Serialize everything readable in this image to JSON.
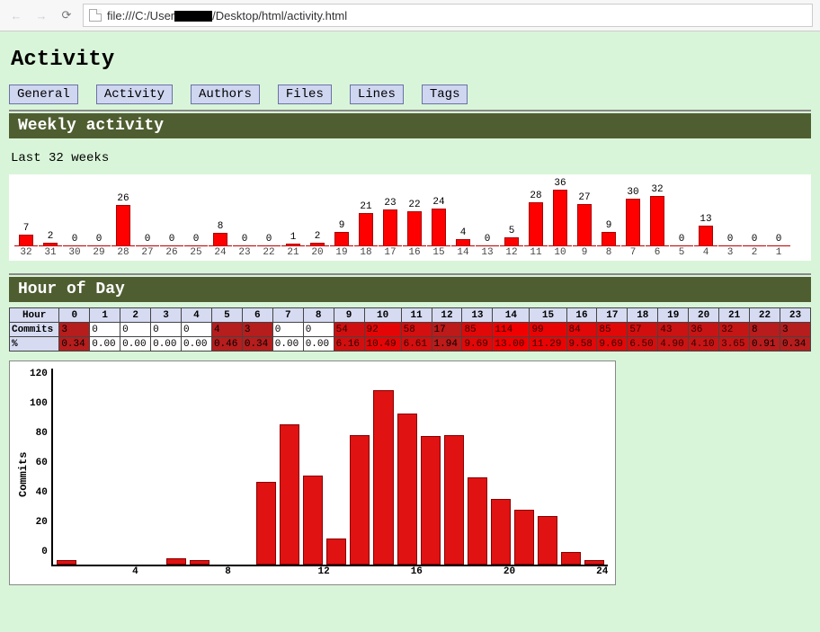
{
  "browser": {
    "url_prefix": "file:///C:/User",
    "url_suffix": "/Desktop/html/activity.html"
  },
  "page": {
    "title": "Activity",
    "tabs": [
      "General",
      "Activity",
      "Authors",
      "Files",
      "Lines",
      "Tags"
    ]
  },
  "weekly": {
    "header": "Weekly activity",
    "subtitle": "Last 32 weeks",
    "weeks": [
      {
        "label": "32",
        "value": 7
      },
      {
        "label": "31",
        "value": 2
      },
      {
        "label": "30",
        "value": 0
      },
      {
        "label": "29",
        "value": 0
      },
      {
        "label": "28",
        "value": 26
      },
      {
        "label": "27",
        "value": 0
      },
      {
        "label": "26",
        "value": 0
      },
      {
        "label": "25",
        "value": 0
      },
      {
        "label": "24",
        "value": 8
      },
      {
        "label": "23",
        "value": 0
      },
      {
        "label": "22",
        "value": 0
      },
      {
        "label": "21",
        "value": 1
      },
      {
        "label": "20",
        "value": 2
      },
      {
        "label": "19",
        "value": 9
      },
      {
        "label": "18",
        "value": 21
      },
      {
        "label": "17",
        "value": 23
      },
      {
        "label": "16",
        "value": 22
      },
      {
        "label": "15",
        "value": 24
      },
      {
        "label": "14",
        "value": 4
      },
      {
        "label": "13",
        "value": 0
      },
      {
        "label": "12",
        "value": 5
      },
      {
        "label": "11",
        "value": 28
      },
      {
        "label": "10",
        "value": 36
      },
      {
        "label": "9",
        "value": 27
      },
      {
        "label": "8",
        "value": 9
      },
      {
        "label": "7",
        "value": 30
      },
      {
        "label": "6",
        "value": 32
      },
      {
        "label": "5",
        "value": 0
      },
      {
        "label": "4",
        "value": 13
      },
      {
        "label": "3",
        "value": 0
      },
      {
        "label": "2",
        "value": 0
      },
      {
        "label": "1",
        "value": 0
      }
    ]
  },
  "hour_of_day": {
    "header": "Hour of Day",
    "col_header": "Hour",
    "row_headers": [
      "Commits",
      "%"
    ],
    "hours": [
      "0",
      "1",
      "2",
      "3",
      "4",
      "5",
      "6",
      "7",
      "8",
      "9",
      "10",
      "11",
      "12",
      "13",
      "14",
      "15",
      "16",
      "17",
      "18",
      "19",
      "20",
      "21",
      "22",
      "23"
    ],
    "commits": [
      3,
      0,
      0,
      0,
      0,
      4,
      3,
      0,
      0,
      54,
      92,
      58,
      17,
      85,
      114,
      99,
      84,
      85,
      57,
      43,
      36,
      32,
      8,
      3
    ],
    "percent": [
      "0.34",
      "0.00",
      "0.00",
      "0.00",
      "0.00",
      "0.46",
      "0.34",
      "0.00",
      "0.00",
      "6.16",
      "10.49",
      "6.61",
      "1.94",
      "9.69",
      "13.00",
      "11.29",
      "9.58",
      "9.69",
      "6.50",
      "4.90",
      "4.10",
      "3.65",
      "0.91",
      "0.34"
    ]
  },
  "chart_data": {
    "type": "bar",
    "title": "",
    "xlabel": "",
    "ylabel": "Commits",
    "ylim": [
      0,
      120
    ],
    "yticks": [
      0,
      20,
      40,
      60,
      80,
      100,
      120
    ],
    "xticks": [
      4,
      8,
      12,
      16,
      20,
      24
    ],
    "x": [
      0,
      1,
      2,
      3,
      4,
      5,
      6,
      7,
      8,
      9,
      10,
      11,
      12,
      13,
      14,
      15,
      16,
      17,
      18,
      19,
      20,
      21,
      22,
      23
    ],
    "values": [
      3,
      0,
      0,
      0,
      0,
      4,
      3,
      0,
      0,
      54,
      92,
      58,
      17,
      85,
      114,
      99,
      84,
      85,
      57,
      43,
      36,
      32,
      8,
      3
    ]
  }
}
